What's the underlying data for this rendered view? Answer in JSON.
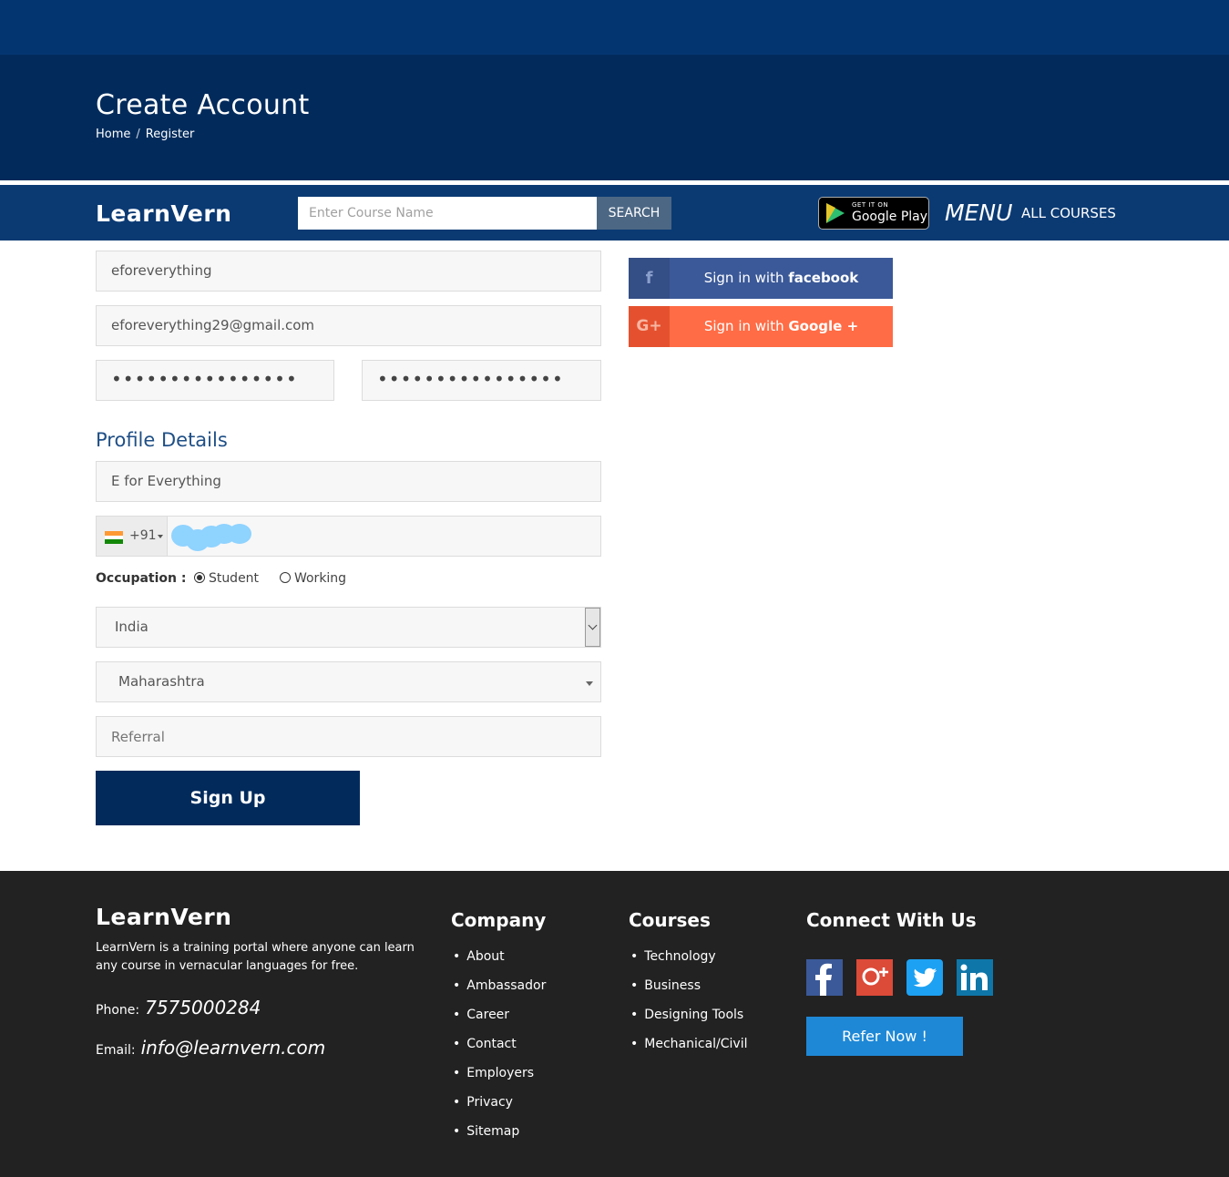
{
  "hero": {
    "title": "Create Account",
    "breadcrumb": [
      "Home",
      "Register"
    ],
    "breadcrumb_sep": "/"
  },
  "navbar": {
    "logo": "LearnVern",
    "search_placeholder": "Enter Course Name",
    "search_button": "SEARCH",
    "play_small": "GET IT ON",
    "play_big": "Google Play",
    "menu": "MENU",
    "all_courses": "ALL COURSES"
  },
  "form": {
    "username": "eforeverything",
    "email": "eforeverything29@gmail.com",
    "password_mask": "••••••••••••••••",
    "confirm_password_mask": "••••••••••••••••",
    "profile_title": "Profile Details",
    "full_name": "E for Everything",
    "phone_code": "+91",
    "occupation_label": "Occupation :",
    "occupation_options": [
      "Student",
      "Working"
    ],
    "occupation_selected": "Student",
    "country": "India",
    "state": "Maharashtra",
    "referral_placeholder": "Referral",
    "signup_button": "Sign Up"
  },
  "social": {
    "facebook_prefix": "Sign in with ",
    "facebook_brand": "facebook",
    "facebook_icon": "f",
    "google_prefix": "Sign in with ",
    "google_brand": "Google +",
    "google_icon": "G+"
  },
  "footer": {
    "logo": "LearnVern",
    "description": "LearnVern is a training portal where anyone can learn any course in vernacular languages for free.",
    "phone_label": "Phone:",
    "phone": "7575000284",
    "email_label": "Email:",
    "email": "info@learnvern.com",
    "company_title": "Company",
    "company_links": [
      "About",
      "Ambassador",
      "Career",
      "Contact",
      "Employers",
      "Privacy",
      "Sitemap"
    ],
    "courses_title": "Courses",
    "courses_links": [
      "Technology",
      "Business",
      "Designing Tools",
      "Mechanical/Civil"
    ],
    "connect_title": "Connect With Us",
    "social_icons": [
      "facebook-icon",
      "google-plus-icon",
      "twitter-icon",
      "linkedin-icon"
    ],
    "refer_button": "Refer Now !"
  },
  "colors": {
    "brand_dark": "#022b5c",
    "facebook": "#3b5998",
    "google": "#ff6c45",
    "refer": "#1e88d6",
    "footer_bg": "#222222"
  }
}
